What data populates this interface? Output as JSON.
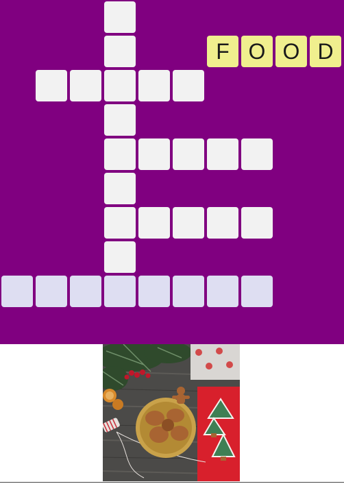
{
  "colors": {
    "board_background": "#800080",
    "empty_cell": "#f2f2f2",
    "active_word_cell": "#dedef2",
    "solved_cell": "#f0ef8e",
    "letter": "#1a1a1a"
  },
  "puzzle": {
    "grid_cols": 10,
    "grid_rows": 10,
    "words": [
      {
        "id": "vertical-c3",
        "direction": "down",
        "start": [
          3,
          0
        ],
        "length": 8,
        "state": "empty",
        "letters": ""
      },
      {
        "id": "across-r2",
        "direction": "across",
        "start": [
          1,
          2
        ],
        "length": 5,
        "state": "empty",
        "letters": ""
      },
      {
        "id": "across-r4",
        "direction": "across",
        "start": [
          3,
          4
        ],
        "length": 5,
        "state": "empty",
        "letters": ""
      },
      {
        "id": "across-r6",
        "direction": "across",
        "start": [
          3,
          6
        ],
        "length": 5,
        "state": "empty",
        "letters": ""
      },
      {
        "id": "across-r8",
        "direction": "across",
        "start": [
          0,
          8
        ],
        "length": 8,
        "state": "active",
        "letters": ""
      },
      {
        "id": "solved-food",
        "direction": "across",
        "start": [
          6,
          1
        ],
        "length": 4,
        "state": "solved",
        "letters": "FOOD"
      }
    ]
  },
  "hint_image": {
    "icon": "christmas-gingerbread-cookies-photo"
  }
}
